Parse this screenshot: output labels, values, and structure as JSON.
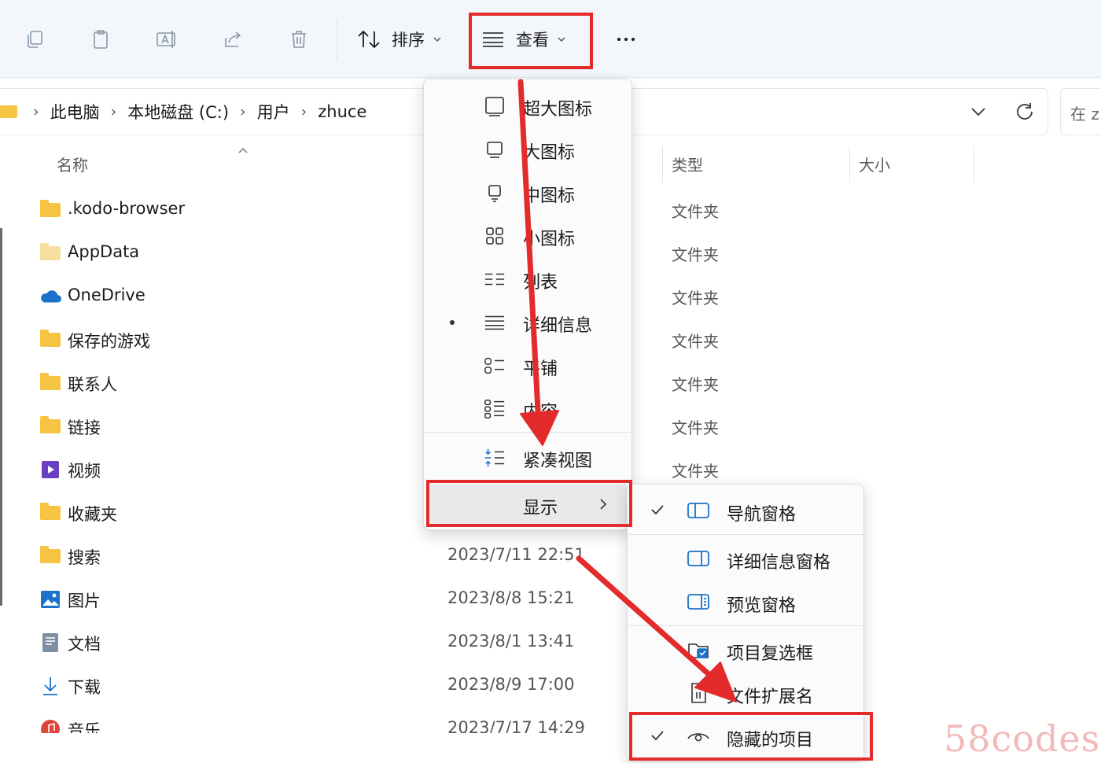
{
  "toolbar": {
    "icons": [
      "copy-icon",
      "paste-icon",
      "rename-icon",
      "share-icon",
      "delete-icon"
    ],
    "sort_label": "排序",
    "view_label": "查看",
    "more_label": "..."
  },
  "address_bar": {
    "crumbs": [
      "此电脑",
      "本地磁盘 (C:)",
      "用户",
      "zhuce"
    ],
    "search_placeholder": "在 z"
  },
  "columns": {
    "name": "名称",
    "type": "类型",
    "size": "大小"
  },
  "files": [
    {
      "name": ".kodo-browser",
      "type": "文件夹",
      "date": "",
      "icon": "folder-icon"
    },
    {
      "name": "AppData",
      "type": "文件夹",
      "date": "",
      "icon": "folder-icon"
    },
    {
      "name": "OneDrive",
      "type": "文件夹",
      "date": "",
      "icon": "onedrive-icon"
    },
    {
      "name": "保存的游戏",
      "type": "文件夹",
      "date": "",
      "icon": "folder-icon"
    },
    {
      "name": "联系人",
      "type": "文件夹",
      "date": "",
      "icon": "folder-icon"
    },
    {
      "name": "链接",
      "type": "文件夹",
      "date": "",
      "icon": "folder-icon"
    },
    {
      "name": "视频",
      "type": "文件夹",
      "date": "",
      "icon": "video-icon"
    },
    {
      "name": "收藏夹",
      "type": "",
      "date": "",
      "icon": "folder-icon"
    },
    {
      "name": "搜索",
      "type": "",
      "date": "2023/7/11 22:51",
      "icon": "folder-icon"
    },
    {
      "name": "图片",
      "type": "",
      "date": "2023/8/8 15:21",
      "icon": "pictures-icon"
    },
    {
      "name": "文档",
      "type": "",
      "date": "2023/8/1 13:41",
      "icon": "documents-icon"
    },
    {
      "name": "下载",
      "type": "",
      "date": "2023/8/9 17:00",
      "icon": "download-icon"
    },
    {
      "name": "音乐",
      "type": "",
      "date": "2023/7/17 14:29",
      "icon": "music-icon"
    }
  ],
  "view_menu": {
    "items": [
      {
        "label": "超大图标",
        "icon": "extra-large-icons-icon",
        "selected": false
      },
      {
        "label": "大图标",
        "icon": "large-icons-icon",
        "selected": false
      },
      {
        "label": "中图标",
        "icon": "medium-icons-icon",
        "selected": false
      },
      {
        "label": "小图标",
        "icon": "small-icons-icon",
        "selected": false
      },
      {
        "label": "列表",
        "icon": "list-view-icon",
        "selected": false
      },
      {
        "label": "详细信息",
        "icon": "details-view-icon",
        "selected": true
      },
      {
        "label": "平铺",
        "icon": "tiles-view-icon",
        "selected": false
      },
      {
        "label": "内容",
        "icon": "content-view-icon",
        "selected": false
      },
      {
        "label": "紧凑视图",
        "icon": "compact-view-icon",
        "selected": false
      }
    ],
    "show_label": "显示"
  },
  "show_submenu": {
    "items": [
      {
        "label": "导航窗格",
        "icon": "navigation-pane-icon",
        "checked": true
      },
      {
        "label": "详细信息窗格",
        "icon": "details-pane-icon",
        "checked": false
      },
      {
        "label": "预览窗格",
        "icon": "preview-pane-icon",
        "checked": false
      },
      {
        "label": "项目复选框",
        "icon": "item-checkbox-icon",
        "checked": false
      },
      {
        "label": "文件扩展名",
        "icon": "file-extension-icon",
        "checked": false
      },
      {
        "label": "隐藏的项目",
        "icon": "hidden-items-icon",
        "checked": true
      }
    ]
  },
  "watermark": "58codes",
  "colors": {
    "highlight": "#e32b2b",
    "folder": "#f6c343",
    "accent": "#1a73c9"
  }
}
